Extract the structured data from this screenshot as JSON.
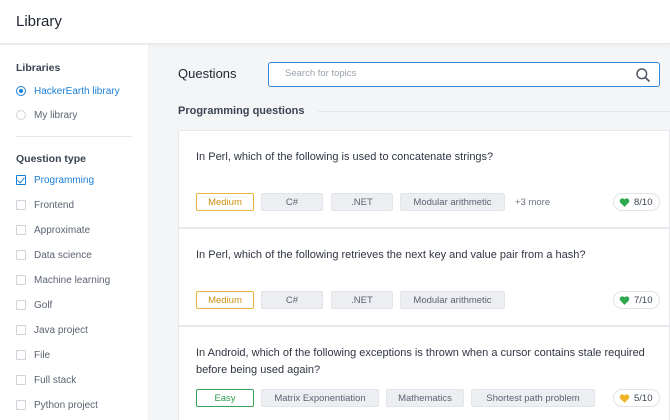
{
  "app": {
    "title": "Library"
  },
  "sidebar": {
    "libraries_title": "Libraries",
    "libraries": [
      {
        "label": "HackerEarth library",
        "selected": true
      },
      {
        "label": "My library",
        "selected": false
      }
    ],
    "question_type_title": "Question type",
    "question_types": [
      {
        "label": "Programming",
        "checked": true
      },
      {
        "label": "Frontend",
        "checked": false
      },
      {
        "label": "Approximate",
        "checked": false
      },
      {
        "label": "Data science",
        "checked": false
      },
      {
        "label": "Machine learning",
        "checked": false
      },
      {
        "label": "Golf",
        "checked": false
      },
      {
        "label": "Java project",
        "checked": false
      },
      {
        "label": "File",
        "checked": false
      },
      {
        "label": "Full stack",
        "checked": false
      },
      {
        "label": "Python project",
        "checked": false
      }
    ]
  },
  "main": {
    "title": "Questions",
    "search": {
      "placeholder": "Search for topics",
      "value": "",
      "icon": "search-icon"
    },
    "section_title": "Programming questions",
    "questions": [
      {
        "text": "In Perl, which of the following is used to concatenate strings?",
        "difficulty": "Medium",
        "tags": [
          "C#",
          ".NET",
          "Modular arithmetic"
        ],
        "more": "+3 more",
        "score": "8/10",
        "score_icon": "green-heart-icon"
      },
      {
        "text": "In Perl, which of the following retrieves the next key and value pair from a hash?",
        "difficulty": "Medium",
        "tags": [
          "C#",
          ".NET",
          "Modular arithmetic"
        ],
        "more": "",
        "score": "7/10",
        "score_icon": "green-heart-icon"
      },
      {
        "text": "In Android, which of the following exceptions is thrown when a cursor contains stale required before being used again?",
        "difficulty": "Easy",
        "tags": [
          "Matrix Exponentiation",
          "Mathematics",
          "Shortest path problem"
        ],
        "more": "",
        "score": "5/10",
        "score_icon": "yellow-heart-icon"
      }
    ]
  },
  "colors": {
    "accent": "#1b7fd6",
    "medium": "#e9b540",
    "easy": "#3aa35a",
    "heart_green": "#2ea84f",
    "heart_yellow": "#f0b429"
  }
}
